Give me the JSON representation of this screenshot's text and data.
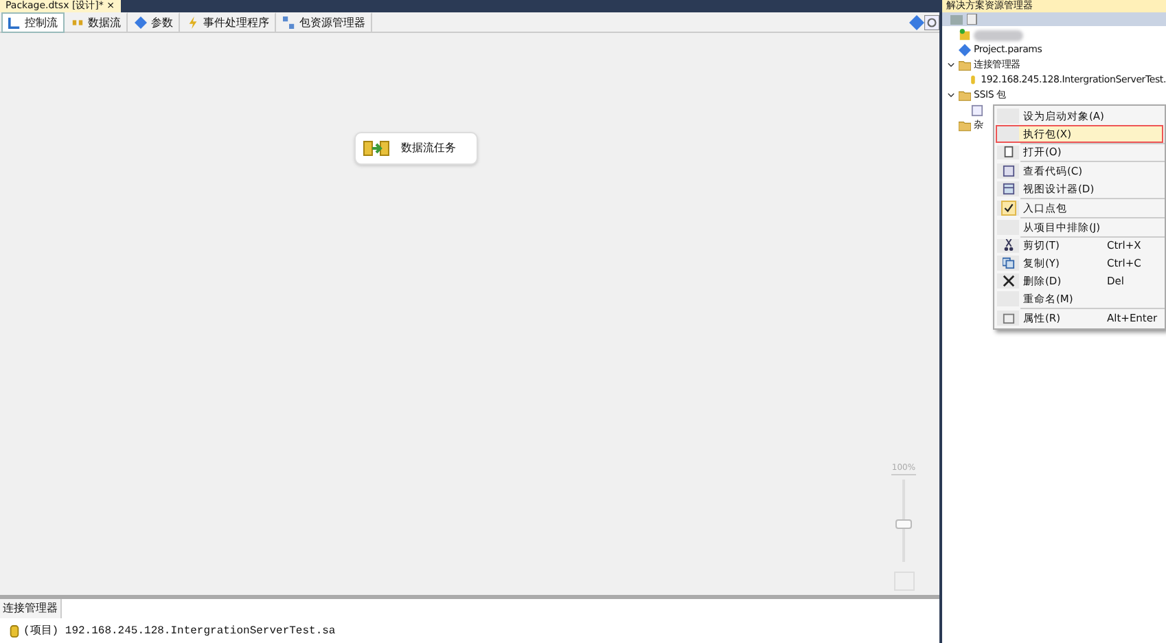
{
  "document_tab": {
    "title": "Package.dtsx [设计]*",
    "close": "×"
  },
  "designer_tabs": [
    {
      "label": "控制流",
      "selected": true
    },
    {
      "label": "数据流",
      "selected": false
    },
    {
      "label": "参数",
      "selected": false
    },
    {
      "label": "事件处理程序",
      "selected": false
    },
    {
      "label": "包资源管理器",
      "selected": false
    }
  ],
  "canvas": {
    "task": {
      "label": "数据流任务"
    },
    "zoom": {
      "label": "100%",
      "level": 0.45
    }
  },
  "connection_managers": {
    "title": "连接管理器",
    "items": [
      "(项目) 192.168.245.128.IntergrationServerTest.sa"
    ]
  },
  "solution_explorer": {
    "title": "解决方案资源管理器",
    "tree": [
      {
        "kind": "project"
      },
      {
        "label": "Project.params",
        "kind": "params"
      },
      {
        "label": "连接管理器",
        "kind": "folder",
        "expanded": true,
        "children": [
          {
            "label": "192.168.245.128.IntergrationServerTest.",
            "kind": "connection"
          }
        ]
      },
      {
        "label": "SSIS 包",
        "kind": "folder",
        "expanded": true,
        "children": [
          {
            "kind": "package"
          }
        ]
      },
      {
        "label": "杂",
        "kind": "folder"
      }
    ]
  },
  "context_menu": [
    {
      "kind": "item",
      "label": "设为启动对象(A)",
      "checked": false,
      "selected": false
    },
    {
      "kind": "item",
      "label": "执行包(X)",
      "checked": false,
      "selected": true
    },
    {
      "kind": "separator"
    },
    {
      "kind": "item",
      "label": "打开(O)",
      "checked": false,
      "selected": false
    },
    {
      "kind": "separator"
    },
    {
      "kind": "item",
      "label": "查看代码(C)",
      "checked": false,
      "selected": false
    },
    {
      "kind": "item",
      "label": "视图设计器(D)",
      "checked": false,
      "selected": false
    },
    {
      "kind": "separator"
    },
    {
      "kind": "item",
      "label": "入口点包",
      "checked": true,
      "selected": false
    },
    {
      "kind": "separator"
    },
    {
      "kind": "item",
      "label": "从项目中排除(J)",
      "checked": false,
      "selected": false
    },
    {
      "kind": "separator"
    },
    {
      "kind": "item",
      "label": "剪切(T)",
      "shortcut": "Ctrl+X",
      "checked": false,
      "selected": false
    },
    {
      "kind": "item",
      "label": "复制(Y)",
      "shortcut": "Ctrl+C",
      "checked": false,
      "selected": false
    },
    {
      "kind": "item",
      "label": "删除(D)",
      "shortcut": "Del",
      "checked": false,
      "selected": false
    },
    {
      "kind": "item",
      "label": "重命名(M)",
      "checked": false,
      "selected": false
    },
    {
      "kind": "separator"
    },
    {
      "kind": "item",
      "label": "属性(R)",
      "shortcut": "Alt+Enter",
      "checked": false,
      "selected": false
    }
  ]
}
